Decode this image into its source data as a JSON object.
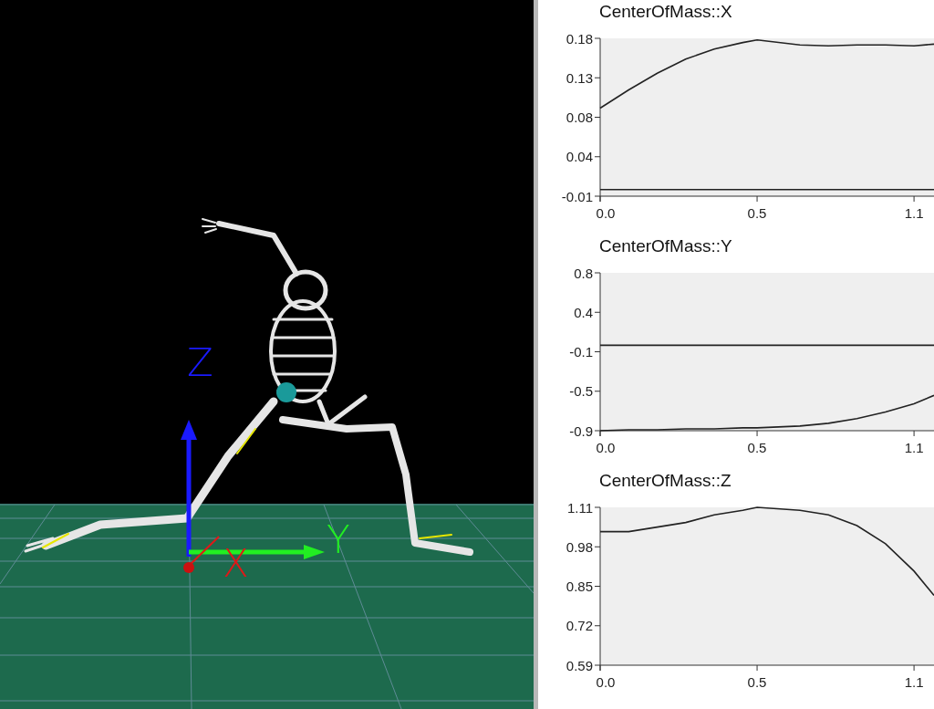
{
  "viewport": {
    "axes": [
      {
        "label": "Z",
        "color": "#1a1aff"
      },
      {
        "label": "X",
        "color": "#e01818"
      },
      {
        "label": "Y",
        "color": "#22ee22"
      }
    ]
  },
  "charts": [
    {
      "chart_data": {
        "type": "line",
        "title": "CenterOfMass::X",
        "x": [
          0,
          0.1,
          0.2,
          0.3,
          0.4,
          0.5,
          0.55,
          0.7,
          0.8,
          0.9,
          1.0,
          1.1,
          1.17
        ],
        "series": [
          {
            "color": "#222222",
            "values": [
              0.096,
              0.118,
              0.138,
              0.155,
              0.167,
              0.175,
              0.178,
              0.172,
              0.171,
              0.172,
              0.172,
              0.171,
              0.173
            ]
          },
          {
            "color": "#222222",
            "values": [
              -0.002,
              -0.002,
              -0.002,
              -0.002,
              -0.002,
              -0.002,
              -0.002,
              -0.002,
              -0.002,
              -0.002,
              -0.002,
              -0.002,
              -0.002
            ]
          }
        ],
        "xlim": [
          0,
          1.17
        ],
        "ylim": [
          -0.01,
          0.18
        ],
        "xticks": [
          {
            "value": 0,
            "label": "0.0"
          },
          {
            "value": 0.55,
            "label": "0.5"
          },
          {
            "value": 1.1,
            "label": "1.1"
          }
        ],
        "yticks": [
          {
            "value": -0.01,
            "label": "-0.01"
          },
          {
            "value": 0.0375,
            "label": "0.04"
          },
          {
            "value": 0.085,
            "label": "0.08"
          },
          {
            "value": 0.1325,
            "label": "0.13"
          },
          {
            "value": 0.18,
            "label": "0.18"
          }
        ]
      }
    },
    {
      "chart_data": {
        "type": "line",
        "title": "CenterOfMass::Y",
        "x": [
          0,
          0.1,
          0.2,
          0.3,
          0.4,
          0.5,
          0.55,
          0.7,
          0.8,
          0.9,
          1.0,
          1.1,
          1.17
        ],
        "series": [
          {
            "color": "#222222",
            "values": [
              -0.9,
              -0.89,
              -0.89,
              -0.88,
              -0.88,
              -0.87,
              -0.87,
              -0.85,
              -0.82,
              -0.77,
              -0.7,
              -0.61,
              -0.52
            ]
          },
          {
            "color": "#222222",
            "values": [
              0.02,
              0.02,
              0.02,
              0.02,
              0.02,
              0.02,
              0.02,
              0.02,
              0.02,
              0.02,
              0.02,
              0.02,
              0.02
            ]
          }
        ],
        "xlim": [
          0,
          1.17
        ],
        "ylim": [
          -0.9,
          0.8
        ],
        "xticks": [
          {
            "value": 0,
            "label": "0.0"
          },
          {
            "value": 0.55,
            "label": "0.5"
          },
          {
            "value": 1.1,
            "label": "1.1"
          }
        ],
        "yticks": [
          {
            "value": -0.9,
            "label": "-0.9"
          },
          {
            "value": -0.475,
            "label": "-0.5"
          },
          {
            "value": -0.05,
            "label": "-0.1"
          },
          {
            "value": 0.375,
            "label": "0.4"
          },
          {
            "value": 0.8,
            "label": "0.8"
          }
        ]
      }
    },
    {
      "chart_data": {
        "type": "line",
        "title": "CenterOfMass::Z",
        "x": [
          0,
          0.1,
          0.2,
          0.3,
          0.4,
          0.5,
          0.55,
          0.7,
          0.8,
          0.9,
          1.0,
          1.1,
          1.17
        ],
        "series": [
          {
            "color": "#222222",
            "values": [
              1.03,
              1.03,
              1.045,
              1.06,
              1.085,
              1.1,
              1.11,
              1.1,
              1.085,
              1.05,
              0.99,
              0.9,
              0.82
            ]
          }
        ],
        "xlim": [
          0,
          1.17
        ],
        "ylim": [
          0.59,
          1.11
        ],
        "xticks": [
          {
            "value": 0,
            "label": "0.0"
          },
          {
            "value": 0.55,
            "label": "0.5"
          },
          {
            "value": 1.1,
            "label": "1.1"
          }
        ],
        "yticks": [
          {
            "value": 0.59,
            "label": "0.59"
          },
          {
            "value": 0.72,
            "label": "0.72"
          },
          {
            "value": 0.85,
            "label": "0.85"
          },
          {
            "value": 0.98,
            "label": "0.98"
          },
          {
            "value": 1.11,
            "label": "1.11"
          }
        ]
      }
    }
  ]
}
